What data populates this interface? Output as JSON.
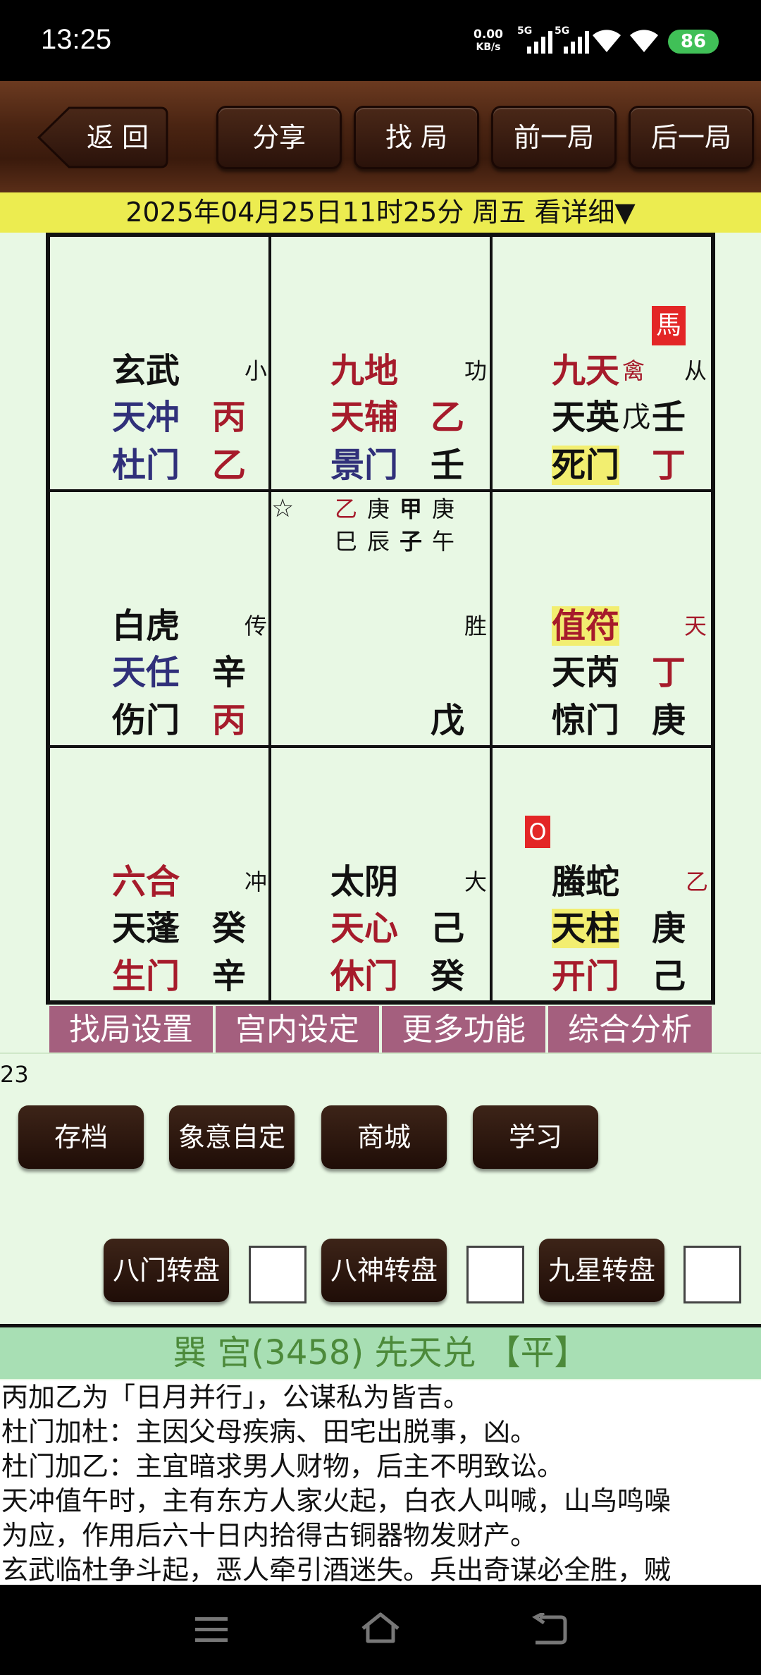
{
  "status": {
    "time": "13:25",
    "net_speed_value": "0.00",
    "net_speed_unit": "KB/s",
    "sig1": "5G",
    "sig2": "5G",
    "battery": "86"
  },
  "toolbar": {
    "back": "返 回",
    "share": "分享",
    "find": "找 局",
    "prev": "前一局",
    "next": "后一局"
  },
  "datebar": "2025年04月25日11时25分 周五 看详细▼",
  "palaces": {
    "c1": {
      "god": "玄武",
      "note": "小",
      "star": "天冲",
      "star_stem": "丙",
      "door": "杜门",
      "door_stem": "乙"
    },
    "c2": {
      "god": "九地",
      "note": "功",
      "star": "天辅",
      "star_stem": "乙",
      "door": "景门",
      "door_stem": "壬"
    },
    "c3": {
      "badge": "馬",
      "god": "九天",
      "god_extra": "禽",
      "note": "从",
      "star": "天英",
      "star_mid": "戊",
      "star_stem": "壬",
      "door": "死门",
      "door_stem": "丁"
    },
    "c4": {
      "god": "白虎",
      "note": "传",
      "star": "天任",
      "star_stem": "辛",
      "door": "伤门",
      "door_stem": "丙"
    },
    "c5": {
      "marker": "☆",
      "pillars_top": [
        "乙",
        "庚",
        "甲",
        "庚"
      ],
      "pillars_bottom": [
        "巳",
        "辰",
        "子",
        "午"
      ],
      "note": "胜",
      "stem": "戊"
    },
    "c6": {
      "god": "值符",
      "note": "天",
      "star": "天芮",
      "star_stem": "丁",
      "door": "惊门",
      "door_stem": "庚"
    },
    "c7": {
      "god": "六合",
      "note": "冲",
      "star": "天蓬",
      "star_stem": "癸",
      "door": "生门",
      "door_stem": "辛"
    },
    "c8": {
      "god": "太阴",
      "note": "大",
      "star": "天心",
      "star_stem": "己",
      "door": "休门",
      "door_stem": "癸"
    },
    "c9": {
      "badge": "O",
      "god": "螣蛇",
      "note": "乙",
      "star": "天柱",
      "star_stem": "庚",
      "door": "开门",
      "door_stem": "己"
    }
  },
  "tabs": [
    "找局设置",
    "宫内设定",
    "更多功能",
    "综合分析"
  ],
  "counter": "23",
  "buttons": {
    "save": "存档",
    "custom": "象意自定",
    "shop": "商城",
    "learn": "学习",
    "door_rotate": "八门转盘",
    "god_rotate": "八神转盘",
    "star_rotate": "九星转盘"
  },
  "panel": {
    "title": "巽 宫(3458) 先天兑 【平】",
    "lines": [
      "丙加乙为「日月并行」，公谋私为皆吉。",
      "杜门加杜：主因父母疾病、田宅出脱事，凶。",
      "杜门加乙：主宜暗求男人财物，后主不明致讼。",
      "天冲值午时，主有东方人家火起，白衣人叫喊，山鸟鸣噪",
      "为应，作用后六十日内拾得古铜器物发财产。",
      "玄武临杜争斗起，恶人牵引酒迷失。兵出奇谋必全胜，贼"
    ]
  },
  "colors": {
    "toolbar": "#4a2412",
    "datebar": "#ecec50",
    "tab": "#a45f7e",
    "panel_head": "#a8dfb4",
    "page_bg": "#e8f8e4",
    "red_text": "#a61b2b",
    "blue_text": "#30307a"
  }
}
